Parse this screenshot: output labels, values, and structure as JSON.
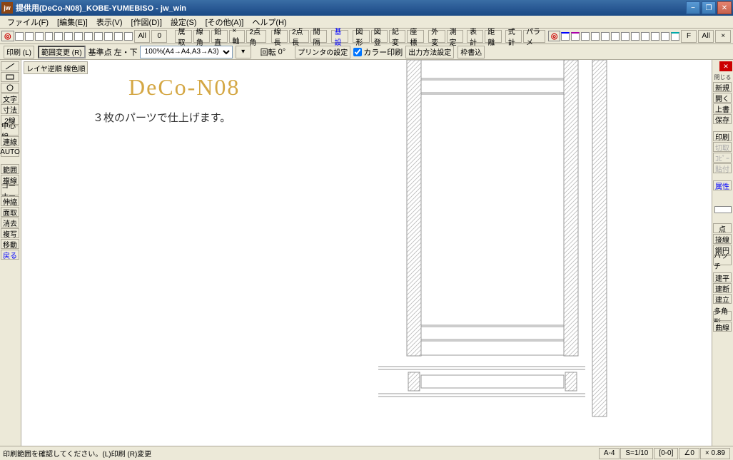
{
  "title": "提供用(DeCo-N08)_KOBE-YUMEBISO - jw_win",
  "app_icon": "jw",
  "menu": [
    "ファイル(F)",
    "[編集(E)]",
    "表示(V)",
    "[作図(D)]",
    "設定(S)",
    "[その他(A)]",
    "ヘルプ(H)"
  ],
  "toolbar1": {
    "all": "All",
    "zero": "0",
    "buttons1": [
      "属取",
      "線角",
      "鉛直",
      "×軸",
      "2点角"
    ],
    "buttons2": [
      "線長",
      "2点長",
      "間隔"
    ],
    "basis": "基設",
    "buttons3": [
      "図形",
      "図登",
      "記変",
      "座標"
    ],
    "buttons4": [
      "外変",
      "測定",
      "表計",
      "距離",
      "式計",
      "パラメ"
    ],
    "f_label": "F",
    "all2": "All",
    "x_label": "×"
  },
  "toolbar2": {
    "print": "印刷 (L)",
    "range": "範囲変更 (R)",
    "basepoint_label": "基準点",
    "basepoint_value": "左・下",
    "scale": "100%(A4→A4,A3→A3)",
    "rotate_label": "回転",
    "rotate_value": "0°",
    "printer_settings": "プリンタの設定",
    "color_print": "カラー印刷",
    "output_settings": "出力方法設定",
    "frame_write": "枠書込"
  },
  "left_tools": [
    "／",
    "□",
    "○",
    "文字",
    "寸法",
    "2線",
    "中心線",
    "連線",
    "AUTO",
    "",
    "範囲",
    "複線",
    "コーナー",
    "伸縮",
    "面取",
    "消去",
    "複写",
    "移動",
    "戻る"
  ],
  "canvas": {
    "layer_btn": "レイヤ逆順 線色順",
    "title": "DeCo-N08",
    "subtitle": "３枚のパーツで仕上げます。"
  },
  "right_tools_top": [
    "新規",
    "開く",
    "上書",
    "保存",
    "",
    "印刷",
    "切取",
    "ｺﾋﾟｰ",
    "貼付",
    "",
    "属性"
  ],
  "right_tools_bottom": [
    "点",
    "接線",
    "鋼円",
    "ハッチ",
    "",
    "建平",
    "建断",
    "建立",
    "",
    "多角形",
    "曲線"
  ],
  "status": {
    "left": "印刷範囲を確認してください。(L)印刷 (R)変更",
    "cells": [
      "A-4",
      "S=1/10",
      "[0-0]",
      "∠0",
      "× 0.89"
    ]
  }
}
